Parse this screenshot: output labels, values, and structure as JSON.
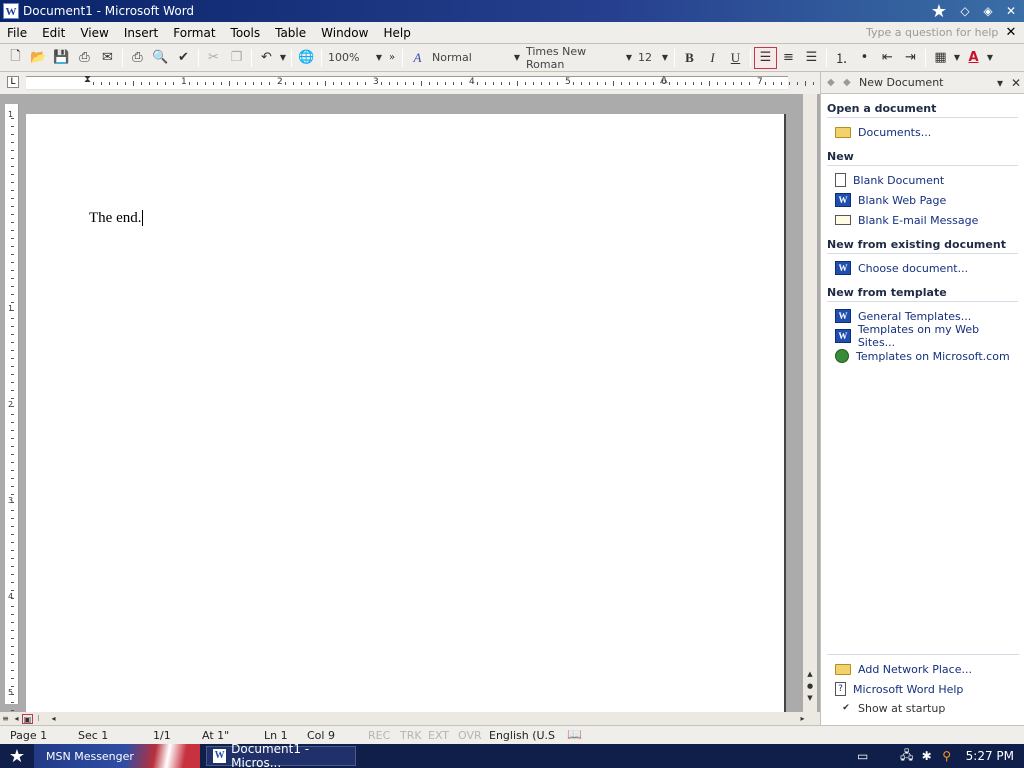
{
  "window": {
    "title": "Document1 - Microsoft Word",
    "app_icon": "word-icon"
  },
  "menu": {
    "items": [
      "File",
      "Edit",
      "View",
      "Insert",
      "Format",
      "Tools",
      "Table",
      "Window",
      "Help"
    ],
    "ask_placeholder": "Type a question for help"
  },
  "toolbar": {
    "zoom": "100%",
    "style": "Normal",
    "font": "Times New Roman",
    "size": "12",
    "bold": "B",
    "italic": "I",
    "underline": "U",
    "alignment_active": "align-left"
  },
  "ruler": {
    "numbers": [
      "1",
      "2",
      "3",
      "4",
      "5",
      "6",
      "7"
    ],
    "vnumbers": [
      "1",
      "1",
      "2",
      "3",
      "4",
      "5"
    ]
  },
  "document": {
    "text": "The end."
  },
  "taskpane": {
    "title": "New Document",
    "sections": [
      {
        "heading": "Open a document",
        "links": [
          {
            "label": "Documents...",
            "icon": "folder-icon"
          }
        ]
      },
      {
        "heading": "New",
        "links": [
          {
            "label": "Blank Document",
            "icon": "blank-document-icon"
          },
          {
            "label": "Blank Web Page",
            "icon": "web-page-icon"
          },
          {
            "label": "Blank E-mail Message",
            "icon": "email-icon"
          }
        ]
      },
      {
        "heading": "New from existing document",
        "links": [
          {
            "label": "Choose document...",
            "icon": "word-doc-icon"
          }
        ]
      },
      {
        "heading": "New from template",
        "links": [
          {
            "label": "General Templates...",
            "icon": "word-doc-icon"
          },
          {
            "label": "Templates on my Web Sites...",
            "icon": "web-templates-icon"
          },
          {
            "label": "Templates on Microsoft.com",
            "icon": "globe-icon"
          }
        ]
      }
    ],
    "bottom": {
      "add_network_place": "Add Network Place...",
      "help": "Microsoft Word Help",
      "show_at_startup": "Show at startup",
      "show_at_startup_checked": true
    }
  },
  "status": {
    "page": "Page 1",
    "sec": "Sec 1",
    "pages": "1/1",
    "at": "At 1\"",
    "ln": "Ln 1",
    "col": "Col 9",
    "rec": "REC",
    "trk": "TRK",
    "ext": "EXT",
    "ovr": "OVR",
    "language": "English (U.S"
  },
  "taskbar": {
    "flag_label": "MSN Messenger",
    "word_button": "Document1 - Micros...",
    "clock": "5:27 PM"
  },
  "colors": {
    "titlebar": "#0a246a",
    "link": "#15307f",
    "active_border": "#c0394a"
  }
}
